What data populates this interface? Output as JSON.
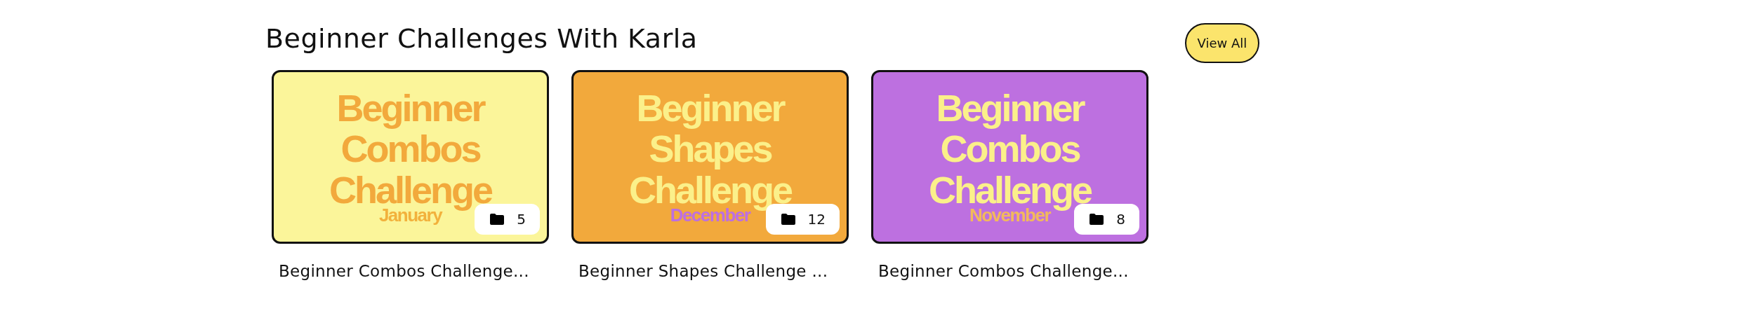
{
  "section": {
    "title": "Beginner Challenges With Karla",
    "view_all": "View All"
  },
  "cards": [
    {
      "cover": {
        "color": "#fbf59a",
        "title": {
          "lines": [
            "Beginner",
            "Combos",
            "Challenge"
          ],
          "color": "#f2a93c"
        },
        "month": {
          "text": "January",
          "color": "#f2b13c"
        }
      },
      "count": "5",
      "title": "Beginner Combos Challenge..."
    },
    {
      "cover": {
        "color": "#f2a93c",
        "title": {
          "lines": [
            "Beginner",
            "Shapes",
            "Challenge"
          ],
          "color": "#fbf08a"
        },
        "month": {
          "text": "December",
          "color": "#bd6fe0"
        }
      },
      "count": "12",
      "title": "Beginner Shapes Challenge ..."
    },
    {
      "cover": {
        "color": "#bd70e0",
        "title": {
          "lines": [
            "Beginner",
            "Combos",
            "Challenge"
          ],
          "color": "#fbf08a"
        },
        "month": {
          "text": "November",
          "color": "#f2b95c"
        }
      },
      "count": "8",
      "title": "Beginner Combos Challenge..."
    }
  ]
}
